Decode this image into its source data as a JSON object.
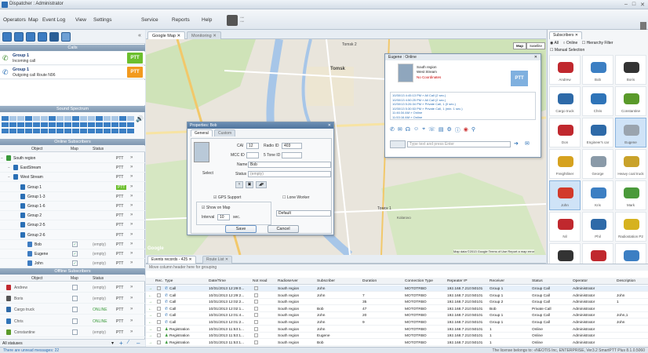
{
  "app": {
    "title": "Dispatcher : Administrator",
    "controls": [
      "–",
      "□",
      "✕"
    ]
  },
  "menu": [
    "Operators",
    "Map",
    "Event Log",
    "View",
    "Settings",
    "Service",
    "Reports",
    "Help"
  ],
  "calls": {
    "header": "Calls",
    "items": [
      {
        "group": "Group 1",
        "status": "Incoming call",
        "ptt": "PTT"
      },
      {
        "group": "Group 1",
        "status": "Outgoing call Route N96",
        "ptt": "PTT"
      }
    ]
  },
  "spectrum": {
    "header": "Sound Spectrum"
  },
  "online": {
    "header": "Online Subscribers",
    "columns": [
      "Object",
      "Map",
      "Status"
    ],
    "rows": [
      {
        "name": "South region",
        "indent": 0,
        "ptt": "PTT"
      },
      {
        "name": "EastStream",
        "indent": 1,
        "ptt": "PTT"
      },
      {
        "name": "West Stream",
        "indent": 1,
        "ptt": "PTT"
      },
      {
        "name": "Group 1",
        "indent": 2,
        "ptt": "PTT"
      },
      {
        "name": "Group 1-3",
        "indent": 2,
        "ptt": "PTT"
      },
      {
        "name": "Group 1-6",
        "indent": 2,
        "ptt": "PTT"
      },
      {
        "name": "Group 2",
        "indent": 2,
        "ptt": "PTT"
      },
      {
        "name": "Group 2-5",
        "indent": 2,
        "ptt": "PTT"
      },
      {
        "name": "Group 2-6",
        "indent": 2,
        "ptt": "PTT"
      },
      {
        "name": "Bob",
        "indent": 3,
        "status": "(empty)",
        "ptt": "PTT"
      },
      {
        "name": "Eugene",
        "indent": 3,
        "status": "(empty)",
        "ptt": "PTT"
      },
      {
        "name": "John",
        "indent": 3,
        "status": "(empty)",
        "ptt": "PTT"
      }
    ]
  },
  "offline": {
    "header": "Offline Subscribers",
    "columns": [
      "Object",
      "Map",
      "Status"
    ],
    "rows": [
      {
        "name": "Andrew",
        "status": "(empty)",
        "ptt": "PTT"
      },
      {
        "name": "Boris",
        "status": "(empty)",
        "ptt": "PTT"
      },
      {
        "name": "Cargo truck",
        "status": "ONLINE",
        "ptt": "PTT"
      },
      {
        "name": "Chris",
        "status": "ONLINE",
        "ptt": "PTT"
      },
      {
        "name": "Constantine",
        "status": "(empty)",
        "ptt": "PTT"
      }
    ],
    "filter": "All statuses"
  },
  "map": {
    "tabs": [
      "Google Map",
      "Monitoring"
    ],
    "type_buttons": [
      "Map",
      "Satellite"
    ],
    "labels": [
      "Tomsk",
      "Tomsk 2",
      "Томск 1",
      "Kolarovo"
    ],
    "copyright": "Map data ©2013 Google  Terms of Use  Report a map error",
    "google": "Google"
  },
  "dialog": {
    "title": "Properties: Bob",
    "tabs": [
      "General",
      "Custom"
    ],
    "cai_label": "CAI",
    "cai": "12",
    "radio_label": "Radio ID",
    "radio": "403",
    "mcc_label": "MCC ID",
    "tone_label": "5 Tone ID",
    "name_label": "Name",
    "name": "Bob",
    "status_label": "Status",
    "status": "(empty)",
    "select": "Select",
    "gps": "GPS Support",
    "show_map": "Show on Map",
    "interval_label": "Interval",
    "interval": "10",
    "interval_unit": "sec.",
    "lone": "Lone Worker",
    "default": "Default",
    "save": "Save",
    "cancel": "Cancel"
  },
  "contact": {
    "title": "Eugene : Online",
    "region": "South region",
    "stream": "West Stream",
    "coords": "No Coordinates",
    "ptt": "PTT",
    "log": [
      "10/30/13 4:45:13 PM » All Call (2 sec.)",
      "10/30/13 4:50:25 PM » All Call (2 sec.)",
      "10/30/13 5:26:34 PM » Private Call, 1 (0 sec.)",
      "10/30/13 5:30:53 PM » Private Call, 1 (min. 1 sec.)",
      "11:46:34 AM » Online",
      "11:53:16 AM » Online"
    ],
    "input_placeholder": "Type text and press Enter"
  },
  "subscribers": {
    "tab": "Subscribers",
    "filters": [
      "All",
      "Online",
      "Hierarchy Filter"
    ],
    "manual": "Manual Selection",
    "tiles": [
      {
        "name": "Andrew",
        "color": "#c0282e"
      },
      {
        "name": "Bob",
        "color": "#3c7fc3"
      },
      {
        "name": "Boris",
        "color": "#333333"
      },
      {
        "name": "Cargo truck",
        "color": "#2e6aa8"
      },
      {
        "name": "Chris",
        "color": "#2f74b8"
      },
      {
        "name": "Constantine",
        "color": "#5a9a2a"
      },
      {
        "name": "Don",
        "color": "#c0282e"
      },
      {
        "name": "Engineer's car",
        "color": "#2e6aa8"
      },
      {
        "name": "Eugene",
        "color": "#9aa4ae"
      },
      {
        "name": "Freightliner",
        "color": "#d6a21f"
      },
      {
        "name": "George",
        "color": "#8a9aa8"
      },
      {
        "name": "Heavy coal truck",
        "color": "#c9a22a"
      },
      {
        "name": "John",
        "color": "#d23a2a"
      },
      {
        "name": "Kris",
        "color": "#3c7fc3"
      },
      {
        "name": "Mark",
        "color": "#4a9a3a"
      },
      {
        "name": "Nil",
        "color": "#c0282e"
      },
      {
        "name": "Phil",
        "color": "#2e6aa8"
      },
      {
        "name": "Radiostation P2",
        "color": "#d6b21f"
      },
      {
        "name": "",
        "color": "#333333"
      },
      {
        "name": "",
        "color": "#c0282e"
      },
      {
        "name": "",
        "color": "#3c7fc3"
      }
    ]
  },
  "events": {
    "tabs": [
      "Events records - 425",
      "Route List"
    ],
    "group_hint": "Move column header here for grouping",
    "columns": [
      "Rec.",
      "Type",
      "Date/Time",
      "Not read",
      "Radioserver",
      "Subscriber",
      "Duration",
      "Connection Type",
      "Repeater IP",
      "Receiver",
      "Status",
      "Operator",
      "Description"
    ],
    "rows": [
      [
        "Call",
        "10/31/2013 12:29:0...",
        "South region",
        "John",
        "",
        "MOTOTRBO",
        "192.168.7.210:50101",
        "Group 1",
        "Group Call",
        "Administrator",
        ""
      ],
      [
        "Call",
        "10/31/2013 12:29:2...",
        "South region",
        "John",
        "7",
        "MOTOTRBO",
        "192.168.7.210:50101",
        "Group 1",
        "Group Call",
        "Administrator",
        "John"
      ],
      [
        "Call",
        "10/31/2013 12:02:2...",
        "South region",
        "",
        "35",
        "MOTOTRBO",
        "192.168.7.210:50101",
        "Group 2",
        "Group Call",
        "Administrator",
        "1"
      ],
      [
        "Call",
        "10/31/2013 12:02:1...",
        "South region",
        "Bob",
        "47",
        "MOTOTRBO",
        "192.168.7.210:50101",
        "Bob",
        "Private Call",
        "Administrator",
        ""
      ],
      [
        "Call",
        "10/31/2013 12:01:4...",
        "South region",
        "John",
        "20",
        "MOTOTRBO",
        "192.168.7.210:50101",
        "Group 1",
        "Group Call",
        "Administrator",
        "John,1"
      ],
      [
        "Call",
        "10/31/2013 12:01:2...",
        "South region",
        "John",
        "9",
        "MOTOTRBO",
        "192.168.7.210:50101",
        "Group 1",
        "Group Call",
        "Administrator",
        "John"
      ],
      [
        "Registration",
        "10/31/2013 11:53:1...",
        "South region",
        "John",
        "",
        "MOTOTRBO",
        "192.168.7.210:50101",
        "1",
        "Online",
        "Administrator",
        ""
      ],
      [
        "Registration",
        "10/31/2013 11:53:1...",
        "South region",
        "Eugene",
        "",
        "MOTOTRBO",
        "192.168.7.210:50101",
        "1",
        "Online",
        "Administrator",
        ""
      ],
      [
        "Registration",
        "10/31/2013 11:53:1...",
        "South region",
        "Bob",
        "",
        "MOTOTRBO",
        "192.168.7.210:50101",
        "1",
        "Online",
        "Administrator",
        ""
      ]
    ]
  },
  "status": {
    "left": "There are unread messages: 22",
    "right": "The license belongs to: «NEOTIS Inc, ENTERPRISE, Ver3.2  SmartPTT Plus 8.1.0.5060"
  }
}
